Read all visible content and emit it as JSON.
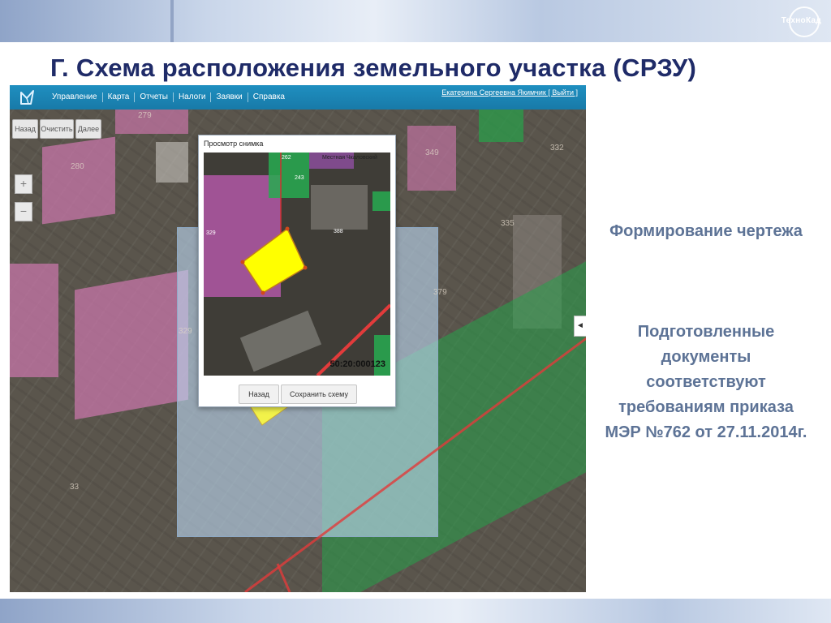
{
  "slide": {
    "title": "Г. Схема расположения земельного участка (СРЗУ)",
    "logo_text": "ТехноКад",
    "side_heading": "Формирование чертежа",
    "side_description": "Подготовленные документы соответствуют требованиям приказа МЭР №762 от 27.11.2014г."
  },
  "app": {
    "menu": [
      "Управление",
      "Карта",
      "Отчеты",
      "Налоги",
      "Заявки",
      "Справка"
    ],
    "user_link": "Екатерина Сергеевна Якимчик [ Выйти ]",
    "map_buttons": {
      "back": "Назад",
      "clear": "Очистить",
      "next": "Далее"
    },
    "zoom": {
      "in": "+",
      "out": "−"
    },
    "panel_toggle": "◄",
    "map_labels": [
      "279",
      "280",
      "349",
      "332",
      "335",
      "329",
      "33",
      "379"
    ],
    "popup": {
      "title": "Просмотр снимка",
      "image_labels": {
        "street": "Местная Чкаловский",
        "p243": "243",
        "p262": "262",
        "p329": "329",
        "p388": "388",
        "cadastral": "50:20:000123"
      },
      "back_button": "Назад",
      "save_button": "Сохранить схему"
    }
  },
  "colors": {
    "title": "#1f2b68",
    "side_text": "#5d7396",
    "toolbar": "#1b86b6",
    "parcel_fill": "#ffff00",
    "road_line": "#e23b3b",
    "pink_parcel": "#c775a8",
    "green_parcel": "#27a24a",
    "blue_overlay": "#bcd7f0"
  }
}
